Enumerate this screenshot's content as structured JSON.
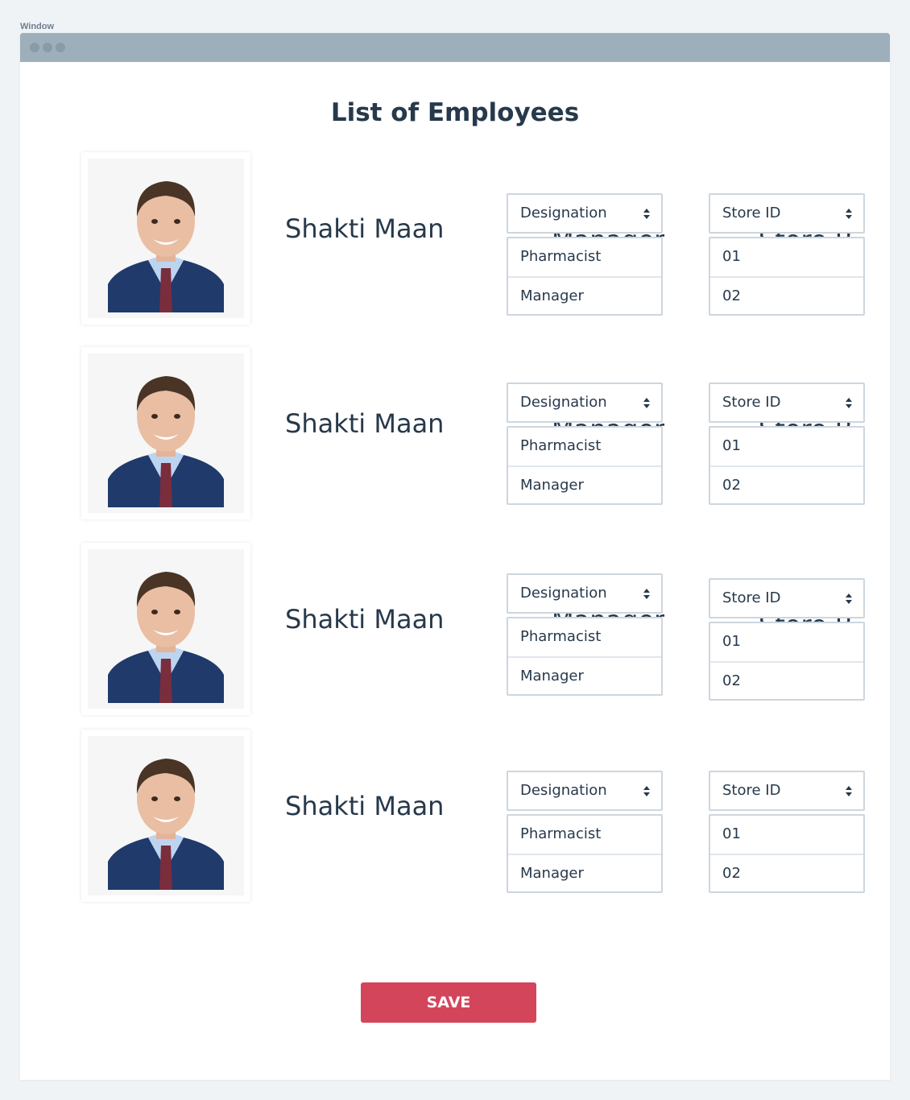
{
  "window": {
    "label": "Window"
  },
  "page": {
    "title": "List of Employees"
  },
  "employees": [
    {
      "name": "Shakti Maan",
      "designation": {
        "label": "Designation",
        "behind_text": "Manager",
        "options": [
          "Pharmacist",
          "Manager"
        ]
      },
      "store": {
        "label": "Store ID",
        "behind_text": "Store B",
        "options": [
          "01",
          "02"
        ]
      }
    },
    {
      "name": "Shakti Maan",
      "designation": {
        "label": "Designation",
        "behind_text": "Manager",
        "options": [
          "Pharmacist",
          "Manager"
        ]
      },
      "store": {
        "label": "Store ID",
        "behind_text": "Store B",
        "options": [
          "01",
          "02"
        ]
      }
    },
    {
      "name": "Shakti Maan",
      "designation": {
        "label": "Designation",
        "behind_text": "Manager",
        "options": [
          "Pharmacist",
          "Manager"
        ]
      },
      "store": {
        "label": "Store ID",
        "behind_text": "Store B",
        "options": [
          "01",
          "02"
        ]
      }
    },
    {
      "name": "Shakti Maan",
      "designation": {
        "label": "Designation",
        "behind_text": "",
        "options": [
          "Pharmacist",
          "Manager"
        ]
      },
      "store": {
        "label": "Store ID",
        "behind_text": "",
        "options": [
          "01",
          "02"
        ]
      }
    }
  ],
  "actions": {
    "save_label": "SAVE"
  },
  "colors": {
    "accent": "#d3455b",
    "titlebar": "#9eafbc",
    "text": "#27394b",
    "border": "#cdd6de"
  },
  "icons": {
    "select_caret": "sort-caret-icon",
    "photo": "person-photo"
  }
}
